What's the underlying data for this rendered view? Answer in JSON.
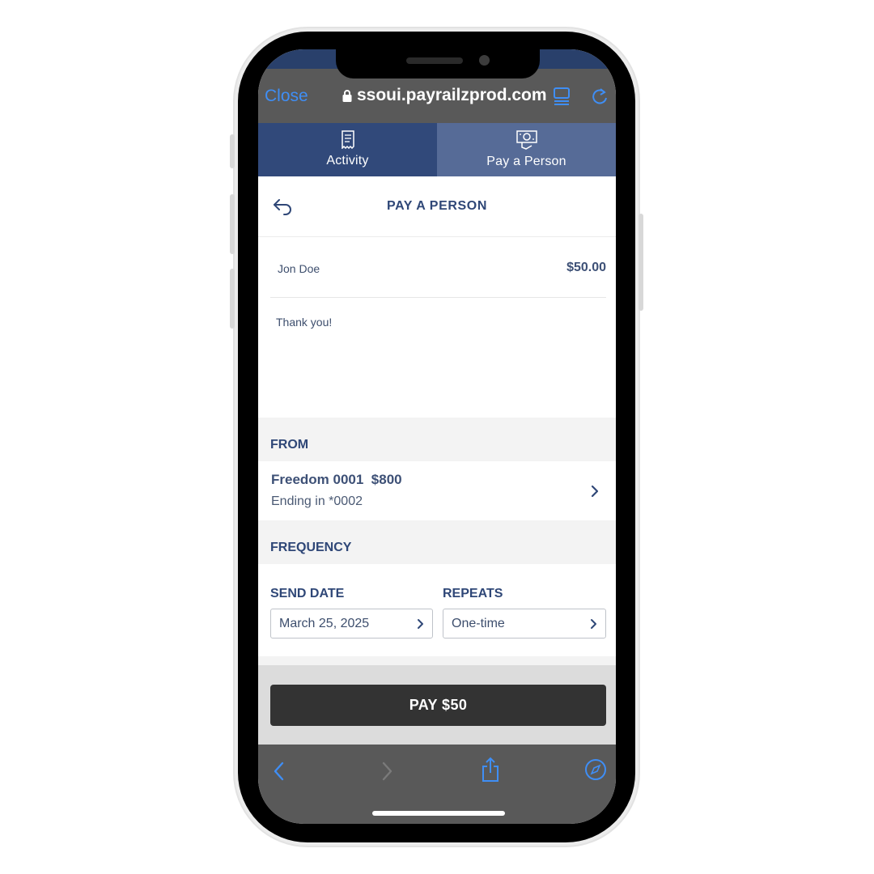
{
  "browser": {
    "close_label": "Close",
    "url": "ssoui.payrailzprod.com"
  },
  "tabs": [
    {
      "label": "Activity",
      "icon": "receipt-icon"
    },
    {
      "label": "Pay a Person",
      "icon": "money-icon"
    }
  ],
  "header": {
    "title": "PAY A PERSON",
    "back_icon": "back-arrow-icon"
  },
  "payee": {
    "name": "Jon Doe",
    "amount": "$50.00"
  },
  "memo": "Thank you!",
  "from": {
    "section_title": "FROM",
    "account_name": "Freedom 0001  $800",
    "account_ending": "Ending in *0002"
  },
  "frequency": {
    "section_title": "FREQUENCY",
    "send_date_label": "SEND DATE",
    "send_date_value": "March 25, 2025",
    "repeats_label": "REPEATS",
    "repeats_value": "One-time"
  },
  "pay_button": "PAY $50",
  "colors": {
    "accent_blue": "#3f8ef5",
    "navy": "#2f4777",
    "tab_active": "#566b97",
    "tab_inactive": "#31497a"
  }
}
